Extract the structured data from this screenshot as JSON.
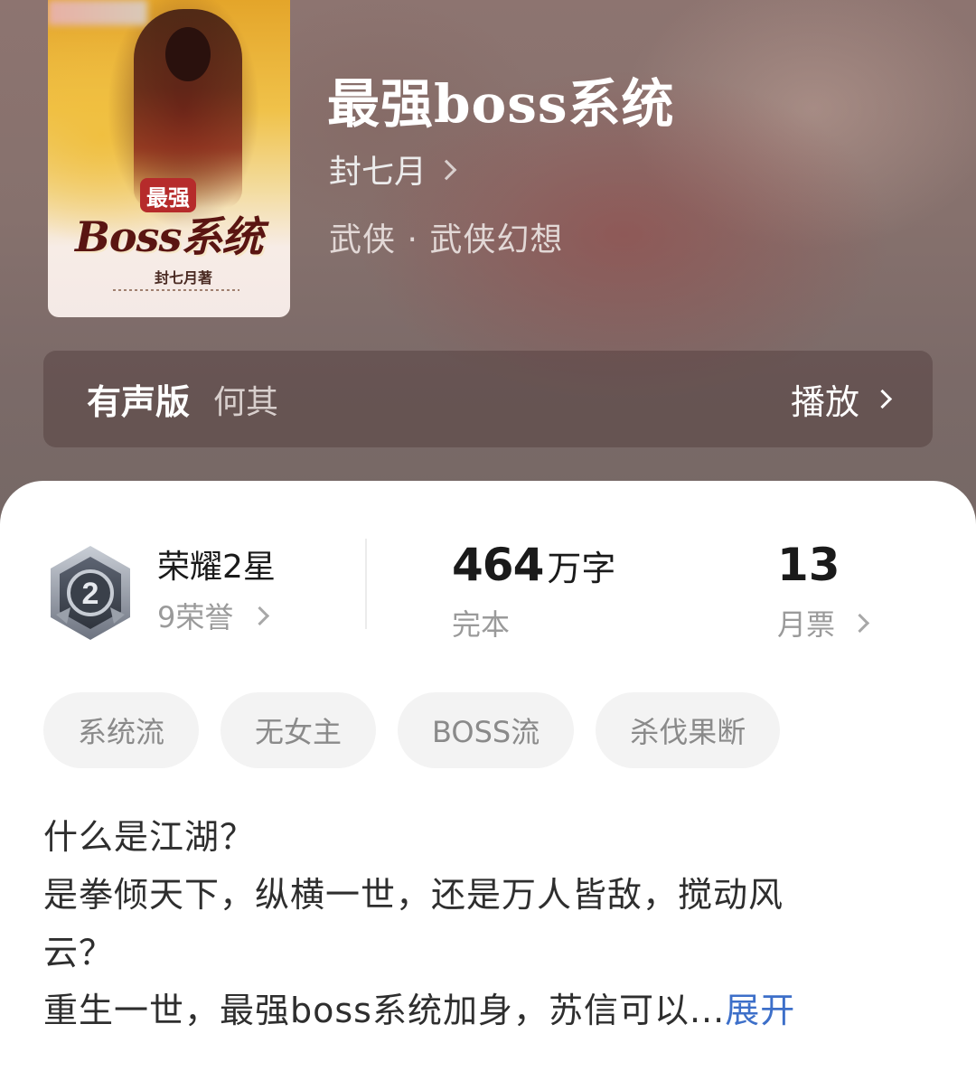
{
  "book": {
    "title": "最强boss系统",
    "author": "封七月",
    "genre": "武侠 · 武侠幻想"
  },
  "cover": {
    "title_small": "最强",
    "title_big": "Boss系统",
    "author": "封七月著"
  },
  "audio": {
    "label": "有声版",
    "narrator": "何其",
    "play_label": "播放"
  },
  "stats": {
    "honor_title": "荣耀2星",
    "honor_count": "9荣誉",
    "badge_level": "2",
    "word_count_num": "464",
    "word_count_unit": "万字",
    "status": "完本",
    "monthly_ticket_num": "13",
    "monthly_ticket_label": "月票"
  },
  "tags": [
    "系统流",
    "无女主",
    "BOSS流",
    "杀伐果断"
  ],
  "synopsis": {
    "lines": [
      "什么是江湖？",
      "是拳倾天下，纵横一世，还是万人皆敌，搅动风",
      "云？",
      "重生一世，最强boss系统加身，苏信可以..."
    ],
    "expand_label": "展开"
  },
  "colors": {
    "link": "#3d6fc9",
    "tag_bg": "#f3f3f3"
  }
}
